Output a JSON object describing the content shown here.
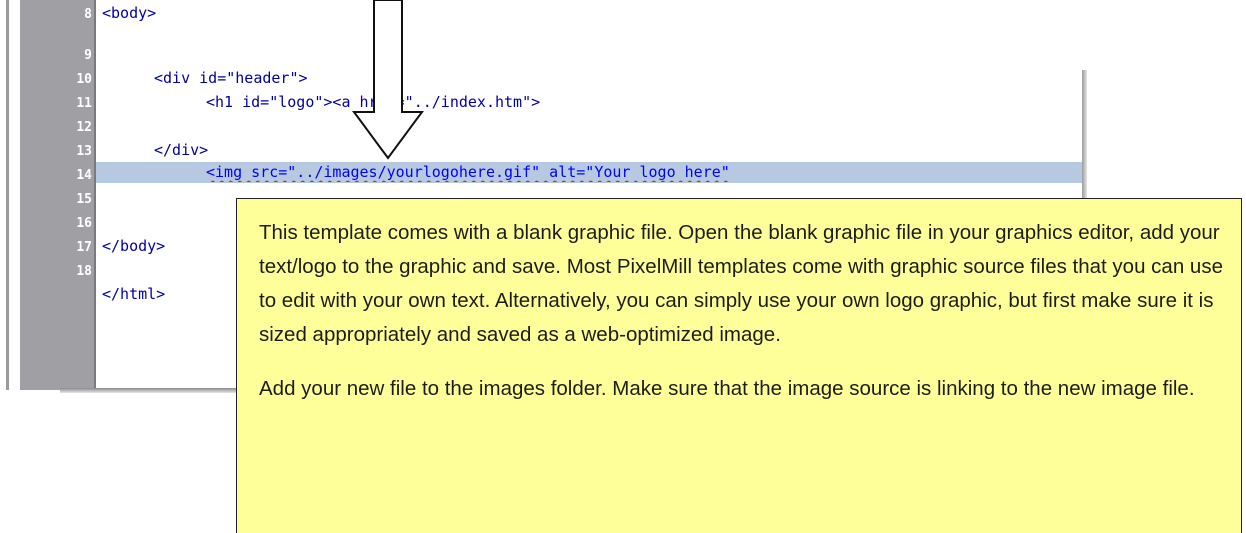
{
  "editor": {
    "lines": [
      {
        "no": "8",
        "text": "<body>"
      },
      {
        "no": "9",
        "text": ""
      },
      {
        "no": "10",
        "text": "<div id=\"header\">"
      },
      {
        "no": "11",
        "text": "<h1 id=\"logo\"><a href=\"../index.htm\">"
      },
      {
        "no": "12",
        "text": "<img src=\"../images/yourlogohere.gif\" alt=\"Your logo here\""
      },
      {
        "no": "13",
        "text": "</div>"
      },
      {
        "no": "14",
        "text": ""
      },
      {
        "no": "15",
        "text": "</body>"
      },
      {
        "no": "16",
        "text": ""
      },
      {
        "no": "17",
        "text": "</html>"
      },
      {
        "no": "18",
        "text": ""
      }
    ],
    "highlighted_line": "12",
    "colors": {
      "gutter": "#a0a0a4",
      "highlight": "#b6c9e1",
      "tag": "#0000a0",
      "value": "#0000ff"
    }
  },
  "callout": {
    "paragraph1": "This template comes with a blank graphic file.  Open the blank graphic file in your graphics editor, add your text/logo to the graphic and save. Most PixelMill templates come with graphic source files that you can use to edit with your own text. Alternatively, you can simply use your own logo graphic, but first make sure it is sized appropriately and saved as a web-optimized image.",
    "paragraph2": "Add your new file to the images folder.  Make sure that the image source is linking to the new image file.",
    "background": "#ffff99"
  }
}
